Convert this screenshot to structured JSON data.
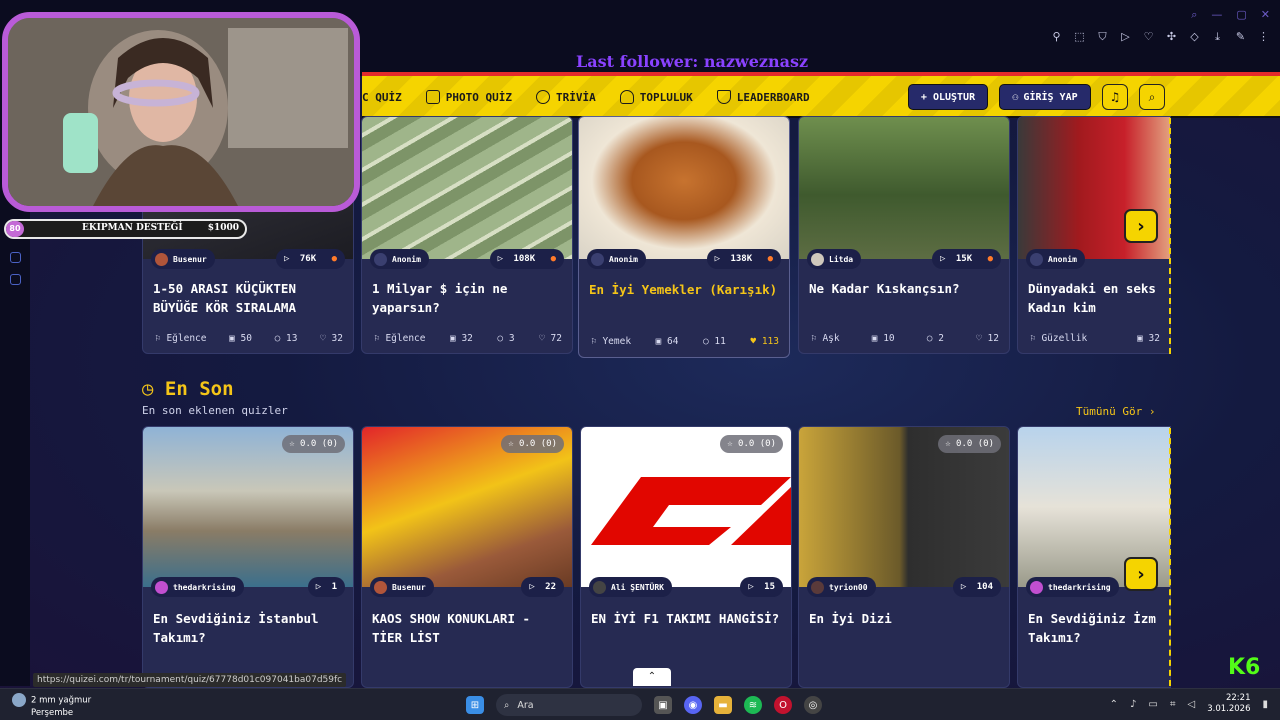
{
  "overlay": {
    "follower_text": "Last follower: nazweznasz",
    "donation": {
      "level": "80",
      "label": "EKIPMAN DESTEĞİ",
      "amount": "$1000"
    },
    "status_url": "https://quizei.com/tr/tournament/quiz/67778d01c097041ba07d59fc"
  },
  "nav": {
    "links": [
      {
        "label": "C QUİZ",
        "icon": "quiz-icon"
      },
      {
        "label": "PHOTO QUİZ",
        "icon": "camera-icon"
      },
      {
        "label": "TRİVİA",
        "icon": "chat-icon"
      },
      {
        "label": "TOPLULUK",
        "icon": "users-icon"
      },
      {
        "label": "LEADERBOARD",
        "icon": "trophy-icon"
      }
    ],
    "create_label": "+ OLUŞTUR",
    "login_label": "GİRİŞ YAP"
  },
  "popular_cards": [
    {
      "author": "Busenur",
      "views": "76K",
      "title": "1-50 ARASI KÜÇÜKTEN BÜYÜĞE KÖR SIRALAMA",
      "category": "Eğlence",
      "questions": "50",
      "comments": "13",
      "likes": "32",
      "gold": false
    },
    {
      "author": "Anonim",
      "views": "108K",
      "title": "1 Milyar $ için ne yaparsın?",
      "category": "Eğlence",
      "questions": "32",
      "comments": "3",
      "likes": "72",
      "gold": false
    },
    {
      "author": "Anonim",
      "views": "138K",
      "title": "En İyi Yemekler (Karışık)",
      "category": "Yemek",
      "questions": "64",
      "comments": "11",
      "likes": "113",
      "gold": true
    },
    {
      "author": "Litda",
      "views": "15K",
      "title": "Ne Kadar Kıskançsın?",
      "category": "Aşk",
      "questions": "10",
      "comments": "2",
      "likes": "12",
      "gold": false
    },
    {
      "author": "Anonim",
      "views": "",
      "title": "Dünyadaki en seks Kadın kim",
      "category": "Güzellik",
      "questions": "32",
      "comments": "",
      "likes": "",
      "gold": false
    }
  ],
  "latest": {
    "title": "En Son",
    "subtitle": "En son eklenen quizler",
    "see_all": "Tümünü Gör ›",
    "cards": [
      {
        "rating": "☆ 0.0 (0)",
        "author": "thedarkrising",
        "count": "1",
        "title": "En Sevdiğiniz İstanbul Takımı?"
      },
      {
        "rating": "☆ 0.0 (0)",
        "author": "Busenur",
        "count": "22",
        "title": "KAOS SHOW KONUKLARI - TİER LİST"
      },
      {
        "rating": "☆ 0.0 (0)",
        "author": "Ali ŞENTÜRK",
        "count": "15",
        "title": "EN İYİ F1 TAKIMI HANGİSİ?"
      },
      {
        "rating": "☆ 0.0 (0)",
        "author": "tyrion00",
        "count": "104",
        "title": "En İyi Dizi"
      },
      {
        "rating": "",
        "author": "thedarkrising",
        "count": "",
        "title": "En Sevdiğiniz İzm Takımı?"
      }
    ]
  },
  "taskbar": {
    "weather_line1": "2 mm yağmur",
    "weather_line2": "Perşembe",
    "search_placeholder": "Ara",
    "time": "22:21",
    "date": "3.01.2026"
  },
  "colors": {
    "accent": "#f5d400",
    "nav_dark": "#262a6a",
    "card_bg": "#262a52",
    "gold_text": "#f5c518"
  }
}
